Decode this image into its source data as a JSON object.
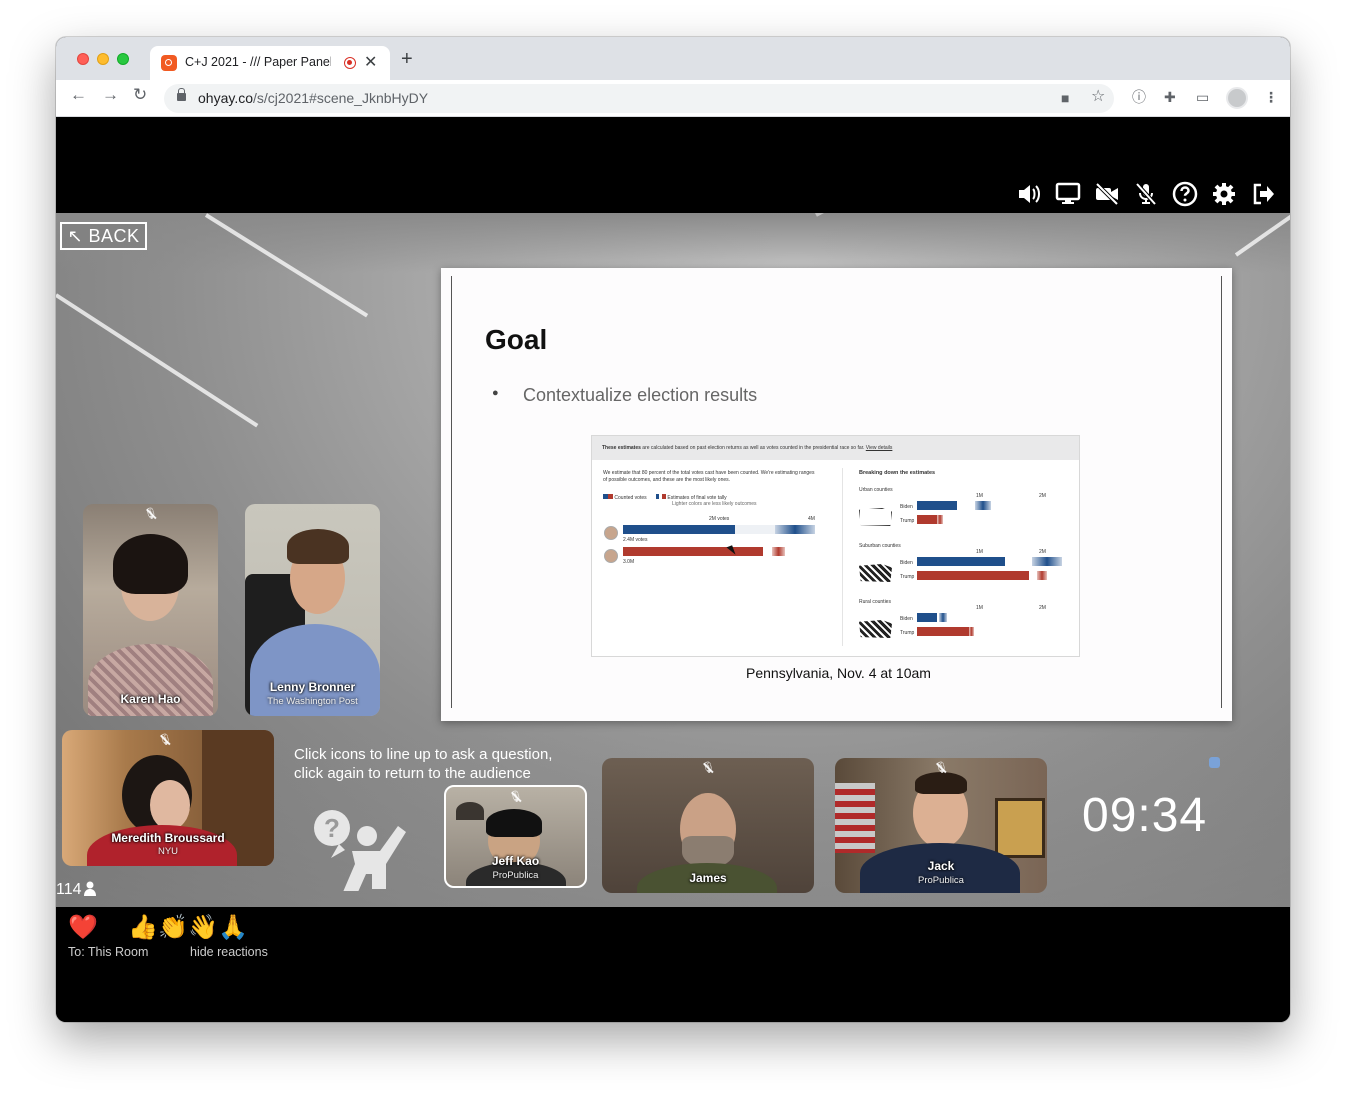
{
  "browser": {
    "tab_title": "C+J 2021 - /// Paper Panel",
    "new_tab": "+",
    "url_host": "ohyay.co",
    "url_path": "/s/cj2021#scene_JknbHyDY"
  },
  "app": {
    "back_label": "BACK",
    "controls": [
      "speaker-icon",
      "screen-share-icon",
      "camera-off-icon",
      "mic-off-icon",
      "help-icon",
      "settings-icon",
      "exit-icon"
    ],
    "slide": {
      "title": "Goal",
      "bullet": "Contextualize election results",
      "caption": "Pennsylvania, Nov. 4 at 10am",
      "embedded": {
        "header_bold": "These estimates",
        "header_text": " are calculated based on past election returns as well as votes counted in the presidential race so far.",
        "header_link": "View details",
        "intro": "We estimate that 80 percent of the total votes cast have been counted. We're estimating ranges of possible outcomes, and these are the most likely ones.",
        "legend_counted": "Counted votes",
        "legend_estimates": "Estimates of final vote tally",
        "legend_note": "Lighter colors are less likely outcomes",
        "axis_2m": "2M votes",
        "axis_4m": "4M",
        "label_biden_total": "2.4M votes",
        "label_trump_total": "3.0M",
        "breakdown_title": "Breaking down the estimates",
        "urban": "Urban counties",
        "suburban": "Suburban counties",
        "rural": "Rural counties",
        "biden": "Biden",
        "trump": "Trump",
        "tick_1m": "1M",
        "tick_2m": "2M"
      }
    },
    "participants": [
      {
        "name": "Karen Hao",
        "org": ""
      },
      {
        "name": "Lenny Bronner",
        "org": "The Washington Post"
      },
      {
        "name": "Meredith Broussard",
        "org": "NYU"
      },
      {
        "name": "Jeff Kao",
        "org": "ProPublica"
      },
      {
        "name": "James",
        "org": ""
      },
      {
        "name": "Jack",
        "org": "ProPublica"
      }
    ],
    "queue_text_line1": "Click icons to line up to ask a question,",
    "queue_text_line2": "click again to return to the audience",
    "timer": "09:34",
    "audience_count": "114",
    "reactions": [
      "❤️",
      "😂",
      "👍",
      "👏",
      "👋",
      "🙏"
    ],
    "reactions_to": "To:  This Room",
    "reactions_hide": "hide reactions"
  },
  "colors": {
    "biden_blue": "#1f4f8b",
    "trump_red": "#b03a2e"
  }
}
